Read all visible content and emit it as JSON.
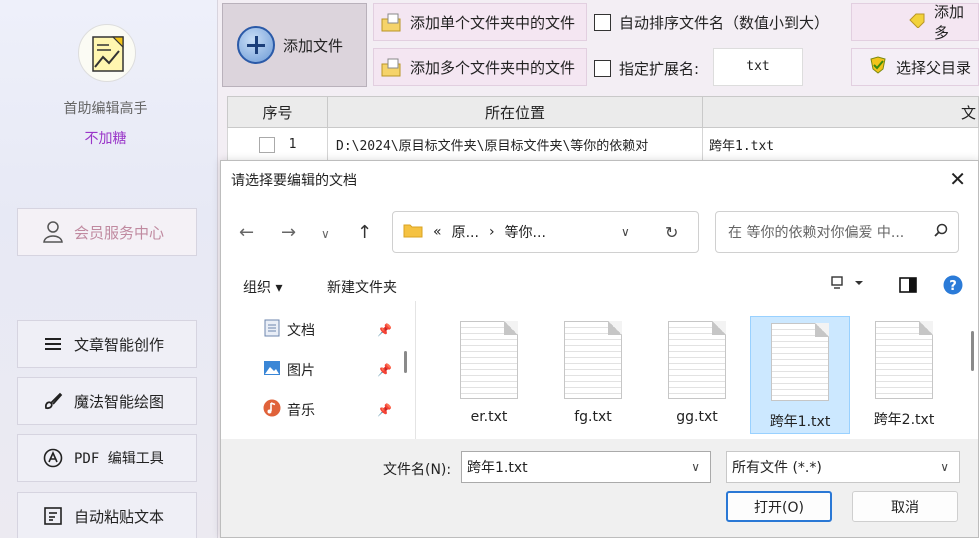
{
  "sidebar": {
    "app_name": "首助编辑高手",
    "app_sub": "不加糖",
    "member_label": "会员服务中心",
    "items": [
      {
        "label": "文章智能创作",
        "icon": "menu-lines-icon"
      },
      {
        "label": "魔法智能绘图",
        "icon": "brush-icon"
      },
      {
        "label": "PDF 编辑工具",
        "icon": "pdf-tool-icon"
      },
      {
        "label": "自动粘贴文本",
        "icon": "paste-icon"
      }
    ]
  },
  "toolbar": {
    "add_file": "添加文件",
    "add_single_folder": "添加单个文件夹中的文件",
    "add_multi_folder": "添加多个文件夹中的文件",
    "auto_sort": "自动排序文件名（数值小到大）",
    "specify_ext": "指定扩展名:",
    "ext_value": "txt",
    "add_more": "添加多",
    "choose_parent": "选择父目录"
  },
  "table": {
    "headers": [
      "序号",
      "所在位置",
      "文"
    ],
    "rows": [
      {
        "index": "1",
        "location": "D:\\2024\\原目标文件夹\\原目标文件夹\\等你的依赖对",
        "name": "跨年1.txt"
      }
    ]
  },
  "dialog": {
    "title": "请选择要编辑的文档",
    "address": [
      "«",
      "原...",
      "›",
      "等你..."
    ],
    "search_placeholder": "在 等你的依赖对你偏爱 中...",
    "organize": "组织 ▾",
    "new_folder": "新建文件夹",
    "nav_items": [
      {
        "label": "文档",
        "icon": "documents-icon"
      },
      {
        "label": "图片",
        "icon": "pictures-icon"
      },
      {
        "label": "音乐",
        "icon": "music-icon"
      }
    ],
    "files": [
      {
        "name": "er.txt",
        "selected": false
      },
      {
        "name": "fg.txt",
        "selected": false
      },
      {
        "name": "gg.txt",
        "selected": false
      },
      {
        "name": "跨年1.txt",
        "selected": true
      },
      {
        "name": "跨年2.txt",
        "selected": false
      }
    ],
    "filename_label": "文件名(N):",
    "filename_value": "跨年1.txt",
    "filetype_value": "所有文件 (*.*)",
    "open_label": "打开(O)",
    "cancel_label": "取消"
  },
  "colors": {
    "accent": "#2a78d5",
    "brand_purple": "#9a36c8",
    "selection": "#cce8ff"
  }
}
